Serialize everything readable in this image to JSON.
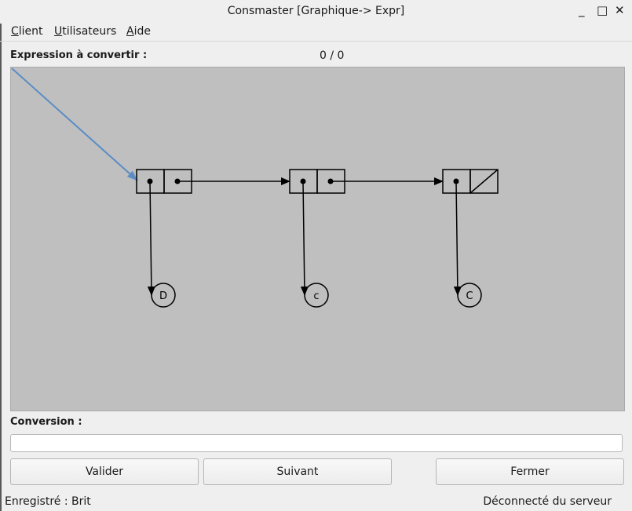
{
  "window": {
    "title": "Consmaster [Graphique-> Expr]",
    "minimize_glyph": "_",
    "maximize_glyph": "□",
    "close_glyph": "✕"
  },
  "menu": {
    "items": [
      {
        "mnemonic": "C",
        "rest": "lient"
      },
      {
        "mnemonic": "U",
        "rest": "tilisateurs"
      },
      {
        "mnemonic": "A",
        "rest": "ide"
      }
    ]
  },
  "expression": {
    "label": "Expression à convertir :",
    "counter": "0 / 0"
  },
  "diagram": {
    "nodes": [
      "D",
      "c",
      "C"
    ]
  },
  "conversion": {
    "label": "Conversion :",
    "value": ""
  },
  "buttons": {
    "valider": "Valider",
    "suivant": "Suivant",
    "fermer": "Fermer"
  },
  "status": {
    "left": "Enregistré : Brit",
    "right": "Déconnecté du serveur"
  }
}
